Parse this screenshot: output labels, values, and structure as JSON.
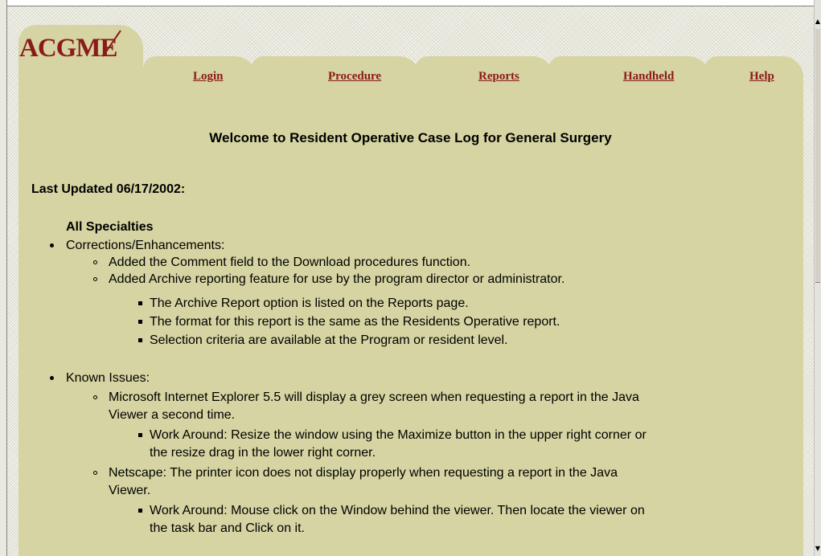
{
  "logo": {
    "text": "ACGME",
    "color": "#8b1a1a"
  },
  "nav": {
    "login": "Login",
    "procedure": "Procedure",
    "reports": "Reports",
    "handheld": "Handheld",
    "help": "Help"
  },
  "page": {
    "title": "Welcome to Resident Operative Case Log for General Surgery",
    "last_updated": "Last Updated 06/17/2002:",
    "section": "All Specialties"
  },
  "content": {
    "corrections": {
      "heading": "Corrections/Enhancements:",
      "item1": "Added the Comment field to the Download procedures function.",
      "item2": "Added Archive reporting feature for use by the program director or administrator.",
      "item2_sub1": "The Archive Report option is listed on the Reports page.",
      "item2_sub2": "The format for this report is the same as the Residents Operative report.",
      "item2_sub3": "Selection criteria are available at the Program or resident level."
    },
    "issues": {
      "heading": "Known Issues:",
      "item1_line1": "Microsoft Internet Explorer 5.5 will display a grey screen when requesting a report in the Java",
      "item1_line2": "Viewer a second time.",
      "item1_sub_line1": "Work Around: Resize the window using the Maximize button in the upper right corner or",
      "item1_sub_line2": "the resize drag in the lower right corner.",
      "item2_line1": "Netscape: The printer icon does not display properly when requesting a report in the Java",
      "item2_line2": "Viewer.",
      "item2_sub_line1": "Work Around: Mouse click on the Window behind the viewer. Then locate the viewer on",
      "item2_sub_line2": "the task bar and Click on it."
    }
  },
  "colors": {
    "tan": "#d5d4a2",
    "link": "#8b1a1a"
  },
  "scrollbar": {
    "up_icon": "▲",
    "down_icon": "▼"
  }
}
